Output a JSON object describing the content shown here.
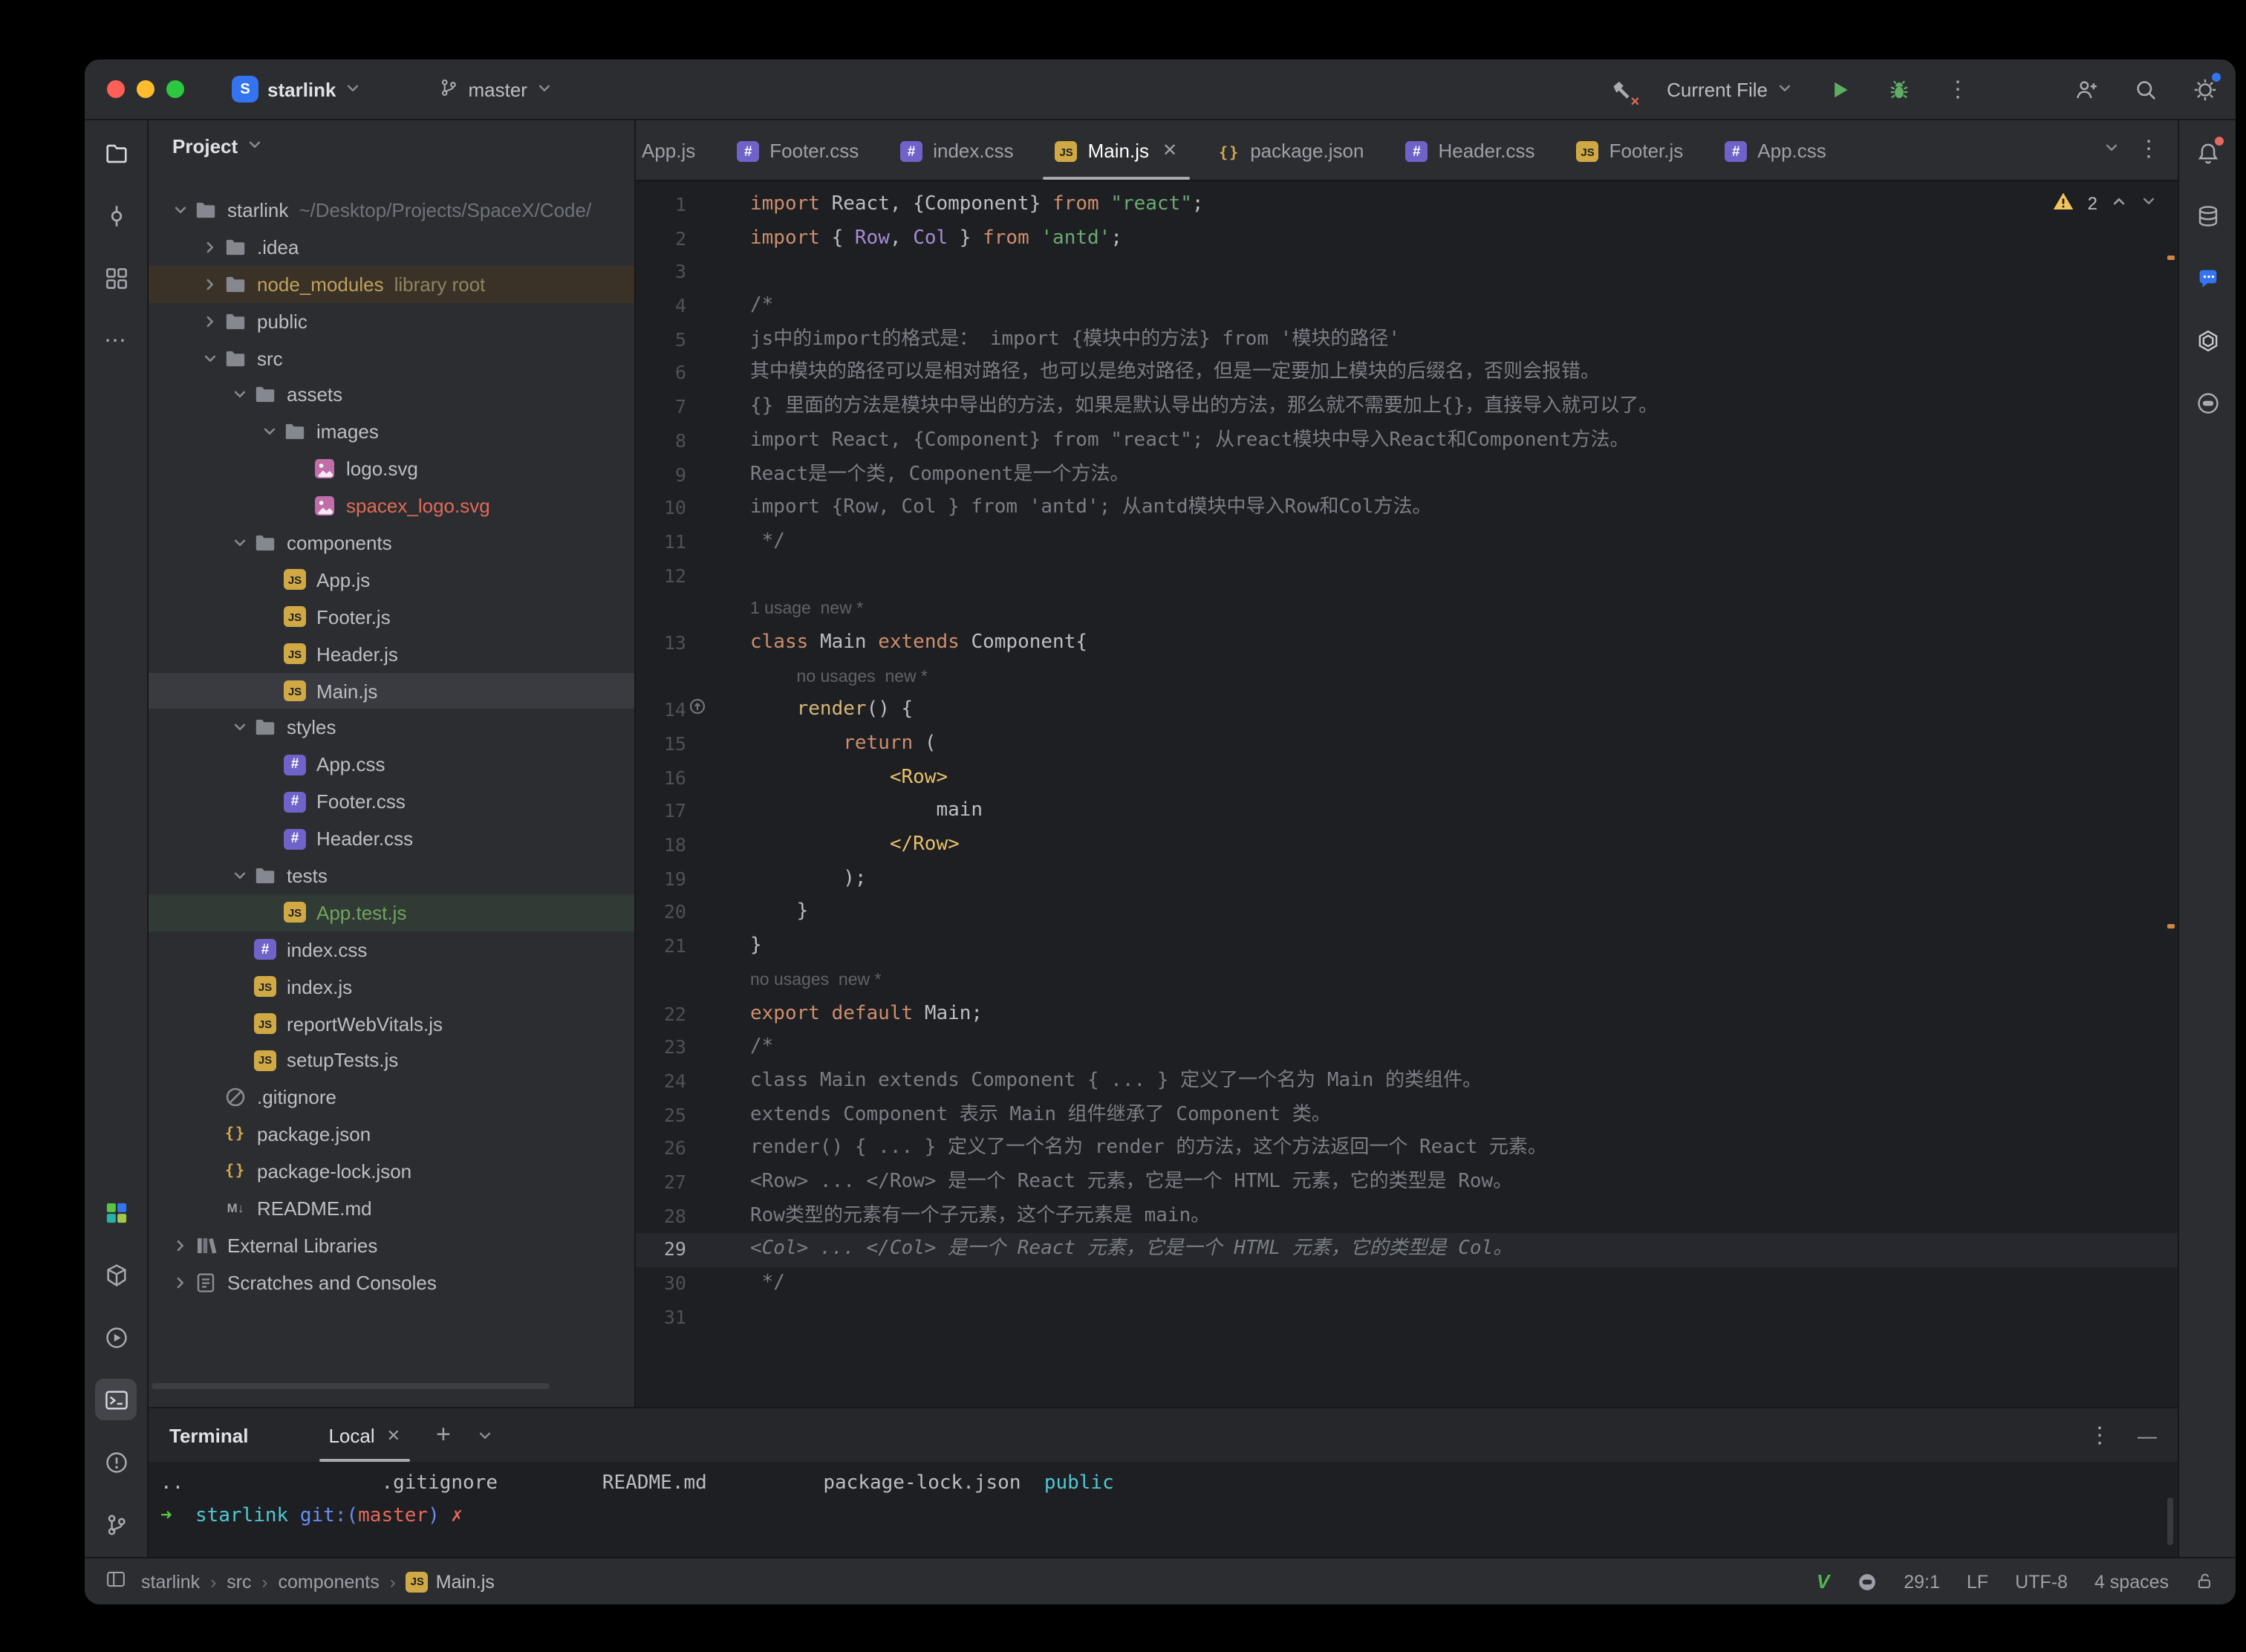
{
  "colors": {
    "accent": "#3574f0",
    "run_green": "#5fad65",
    "warning_yellow": "#f2c55c",
    "error_red": "#e5695c",
    "selected_row": "#393b40",
    "excluded_row_text": "#bfa15e",
    "added_file_green": "#72a35a",
    "unversioned_red": "#e06a57"
  },
  "titlebar": {
    "project": {
      "initial": "S",
      "name": "starlink"
    },
    "branch": {
      "label": "master"
    },
    "run_config": {
      "label": "Current File"
    }
  },
  "activity_bar": {
    "left_top": [
      {
        "icon": "project",
        "name": "project-toolwindow-button",
        "active": true
      },
      {
        "icon": "commit",
        "name": "commit-toolwindow-button"
      },
      {
        "icon": "structure",
        "name": "structure-toolwindow-button"
      },
      {
        "icon": "more",
        "name": "more-toolwindows-button"
      }
    ],
    "left_bottom": [
      {
        "icon": "plugin",
        "name": "plugin-toolwindow-button"
      },
      {
        "icon": "packages",
        "name": "dependencies-toolwindow-button"
      },
      {
        "icon": "runwin",
        "name": "run-toolwindow-button"
      },
      {
        "icon": "terminal",
        "name": "terminal-toolwindow-button",
        "selected": true
      },
      {
        "icon": "problems",
        "name": "problems-toolwindow-button"
      },
      {
        "icon": "vcs",
        "name": "version-control-toolwindow-button"
      }
    ],
    "right": [
      {
        "icon": "bell",
        "name": "notifications-button",
        "badge": true
      },
      {
        "icon": "db",
        "name": "database-toolwindow-button"
      },
      {
        "icon": "bubble",
        "name": "ai-assistant-toolwindow-button"
      },
      {
        "icon": "knot",
        "name": "chatgpt-toolwindow-button"
      },
      {
        "icon": "face",
        "name": "copilot-chat-toolwindow-button"
      }
    ]
  },
  "project_panel": {
    "header": "Project",
    "tree": [
      {
        "ind": 0,
        "exp": "open",
        "icon": "folder",
        "label": "starlink",
        "sub": "~/Desktop/Projects/SpaceX/Code/"
      },
      {
        "ind": 1,
        "exp": "closed",
        "icon": "folder",
        "label": ".idea"
      },
      {
        "ind": 1,
        "exp": "closed",
        "icon": "folder",
        "label": "node_modules",
        "sub": "library root",
        "state": "excluded"
      },
      {
        "ind": 1,
        "exp": "closed",
        "icon": "folder",
        "label": "public"
      },
      {
        "ind": 1,
        "exp": "open",
        "icon": "folder",
        "label": "src"
      },
      {
        "ind": 2,
        "exp": "open",
        "icon": "folder",
        "label": "assets"
      },
      {
        "ind": 3,
        "exp": "open",
        "icon": "folder",
        "label": "images"
      },
      {
        "ind": 4,
        "icon": "image",
        "label": "logo.svg"
      },
      {
        "ind": 4,
        "icon": "image",
        "label": "spacex_logo.svg",
        "state": "unversioned"
      },
      {
        "ind": 2,
        "exp": "open",
        "icon": "folder",
        "label": "components"
      },
      {
        "ind": 3,
        "icon": "js",
        "label": "App.js"
      },
      {
        "ind": 3,
        "icon": "js",
        "label": "Footer.js"
      },
      {
        "ind": 3,
        "icon": "js",
        "label": "Header.js"
      },
      {
        "ind": 3,
        "icon": "js",
        "label": "Main.js",
        "state": "selected"
      },
      {
        "ind": 2,
        "exp": "open",
        "icon": "folder",
        "label": "styles"
      },
      {
        "ind": 3,
        "icon": "css",
        "label": "App.css"
      },
      {
        "ind": 3,
        "icon": "css",
        "label": "Footer.css"
      },
      {
        "ind": 3,
        "icon": "css",
        "label": "Header.css"
      },
      {
        "ind": 2,
        "exp": "open",
        "icon": "folder",
        "label": "tests"
      },
      {
        "ind": 3,
        "icon": "js",
        "label": "App.test.js",
        "state": "added"
      },
      {
        "ind": 2,
        "icon": "css",
        "label": "index.css"
      },
      {
        "ind": 2,
        "icon": "js",
        "label": "index.js"
      },
      {
        "ind": 2,
        "icon": "js",
        "label": "reportWebVitals.js"
      },
      {
        "ind": 2,
        "icon": "js",
        "label": "setupTests.js"
      },
      {
        "ind": 1,
        "icon": "ignore",
        "label": ".gitignore"
      },
      {
        "ind": 1,
        "icon": "json",
        "label": "package.json"
      },
      {
        "ind": 1,
        "icon": "json",
        "label": "package-lock.json"
      },
      {
        "ind": 1,
        "icon": "md",
        "label": "README.md"
      },
      {
        "ind": 0,
        "exp": "closed",
        "icon": "lib",
        "label": "External Libraries"
      },
      {
        "ind": 0,
        "exp": "closed",
        "icon": "scratch",
        "label": "Scratches and Consoles"
      }
    ]
  },
  "editor": {
    "warnings": "2",
    "tabs": [
      {
        "icon": "js",
        "label": "App.js",
        "clipped": true
      },
      {
        "icon": "css",
        "label": "Footer.css"
      },
      {
        "icon": "css",
        "label": "index.css"
      },
      {
        "icon": "js",
        "label": "Main.js",
        "active": true,
        "close": true
      },
      {
        "icon": "json",
        "label": "package.json"
      },
      {
        "icon": "css",
        "label": "Header.css"
      },
      {
        "icon": "js",
        "label": "Footer.js"
      },
      {
        "icon": "css",
        "label": "App.css"
      }
    ],
    "lines": [
      {
        "n": 1,
        "seg": [
          [
            "kw",
            "import "
          ],
          [
            "df",
            "React, {Component} "
          ],
          [
            "kw",
            "from "
          ],
          [
            "st",
            "\"react\""
          ],
          [
            "df",
            ";"
          ]
        ]
      },
      {
        "n": 2,
        "seg": [
          [
            "kw",
            "import "
          ],
          [
            "df",
            "{ "
          ],
          [
            "im",
            "Row"
          ],
          [
            "df",
            ", "
          ],
          [
            "im",
            "Col"
          ],
          [
            "df",
            " } "
          ],
          [
            "kw",
            "from "
          ],
          [
            "st",
            "'antd'"
          ],
          [
            "df",
            ";"
          ]
        ]
      },
      {
        "n": 3,
        "seg": []
      },
      {
        "n": 4,
        "seg": [
          [
            "cm",
            "/*"
          ]
        ]
      },
      {
        "n": 5,
        "seg": [
          [
            "cm",
            "js中的import的格式是： import {模块中的方法} from '模块的路径'"
          ]
        ]
      },
      {
        "n": 6,
        "seg": [
          [
            "cm",
            "其中模块的路径可以是相对路径，也可以是绝对路径，但是一定要加上模块的后缀名，否则会报错。"
          ]
        ]
      },
      {
        "n": 7,
        "seg": [
          [
            "cm",
            "{} 里面的方法是模块中导出的方法，如果是默认导出的方法，那么就不需要加上{}，直接导入就可以了。"
          ]
        ]
      },
      {
        "n": 8,
        "seg": [
          [
            "cm",
            "import React, {Component} from \"react\"; 从react模块中导入React和Component方法。"
          ]
        ]
      },
      {
        "n": 9,
        "seg": [
          [
            "cm",
            "React是一个类, Component是一个方法。"
          ]
        ]
      },
      {
        "n": 10,
        "seg": [
          [
            "cm",
            "import {Row, Col } from 'antd'; 从antd模块中导入Row和Col方法。"
          ]
        ]
      },
      {
        "n": 11,
        "seg": [
          [
            "cm",
            " */"
          ]
        ]
      },
      {
        "n": 12,
        "seg": []
      },
      {
        "hint": "1 usage  new *",
        "ind": 0
      },
      {
        "n": 13,
        "seg": [
          [
            "kw",
            "class "
          ],
          [
            "df",
            "Main "
          ],
          [
            "kw",
            "extends "
          ],
          [
            "df",
            "Component{"
          ]
        ]
      },
      {
        "hint": "no usages  new *",
        "ind": 4
      },
      {
        "n": 14,
        "g": "override",
        "seg": [
          [
            "df",
            "    "
          ],
          [
            "fn",
            "render"
          ],
          [
            "df",
            "() {"
          ]
        ]
      },
      {
        "n": 15,
        "seg": [
          [
            "df",
            "        "
          ],
          [
            "kw",
            "return"
          ],
          [
            "df",
            " ("
          ]
        ]
      },
      {
        "n": 16,
        "seg": [
          [
            "df",
            "            "
          ],
          [
            "tg",
            "<Row>"
          ]
        ]
      },
      {
        "n": 17,
        "seg": [
          [
            "df",
            "                main"
          ]
        ]
      },
      {
        "n": 18,
        "seg": [
          [
            "df",
            "            "
          ],
          [
            "tg",
            "</Row>"
          ]
        ]
      },
      {
        "n": 19,
        "seg": [
          [
            "df",
            "        );"
          ]
        ]
      },
      {
        "n": 20,
        "seg": [
          [
            "df",
            "    }"
          ]
        ]
      },
      {
        "n": 21,
        "seg": [
          [
            "df",
            "}"
          ]
        ]
      },
      {
        "hint": "no usages  new *",
        "ind": 0
      },
      {
        "n": 22,
        "seg": [
          [
            "kw",
            "export default "
          ],
          [
            "df",
            "Main;"
          ]
        ]
      },
      {
        "n": 23,
        "seg": [
          [
            "cm",
            "/*"
          ]
        ]
      },
      {
        "n": 24,
        "seg": [
          [
            "cm",
            "class Main extends Component { ... } 定义了一个名为 Main 的类组件。"
          ]
        ]
      },
      {
        "n": 25,
        "seg": [
          [
            "cm",
            "extends Component 表示 Main 组件继承了 Component 类。"
          ]
        ]
      },
      {
        "n": 26,
        "seg": [
          [
            "cm",
            "render() { ... } 定义了一个名为 render 的方法，这个方法返回一个 React 元素。"
          ]
        ]
      },
      {
        "n": 27,
        "seg": [
          [
            "cm",
            "<Row> ... </Row> 是一个 React 元素，它是一个 HTML 元素，它的类型是 Row。"
          ]
        ]
      },
      {
        "n": 28,
        "seg": [
          [
            "cm",
            "Row类型的元素有一个子元素，这个子元素是 main。"
          ]
        ]
      },
      {
        "n": 29,
        "caret": true,
        "seg": [
          [
            "cmi",
            "<Col> ... </Col> 是一个 React 元素，它是一个 HTML 元素，它的类型是 Col。"
          ]
        ]
      },
      {
        "n": 30,
        "seg": [
          [
            "cm",
            " */"
          ]
        ]
      },
      {
        "n": 31,
        "seg": []
      }
    ]
  },
  "terminal": {
    "title": "Terminal",
    "tab_label": "Local",
    "lines": [
      [
        [
          "w",
          ".."
        ],
        [
          "w",
          "                 "
        ],
        [
          "w",
          ".gitignore"
        ],
        [
          "w",
          "         "
        ],
        [
          "w",
          "README.md"
        ],
        [
          "w",
          "          "
        ],
        [
          "w",
          "package-lock.json"
        ],
        [
          "w",
          "  "
        ],
        [
          "c",
          "public"
        ]
      ],
      [
        [
          "g",
          "➜"
        ],
        [
          "w",
          "  "
        ],
        [
          "c",
          "starlink"
        ],
        [
          "w",
          " "
        ],
        [
          "b",
          "git:("
        ],
        [
          "r",
          "master"
        ],
        [
          "b",
          ")"
        ],
        [
          "w",
          " "
        ],
        [
          "r",
          "✗"
        ]
      ]
    ]
  },
  "status_bar": {
    "breadcrumbs": [
      "starlink",
      "src",
      "components"
    ],
    "file": "Main.js",
    "caret": "29:1",
    "line_sep": "LF",
    "encoding": "UTF-8",
    "indent": "4 spaces"
  }
}
